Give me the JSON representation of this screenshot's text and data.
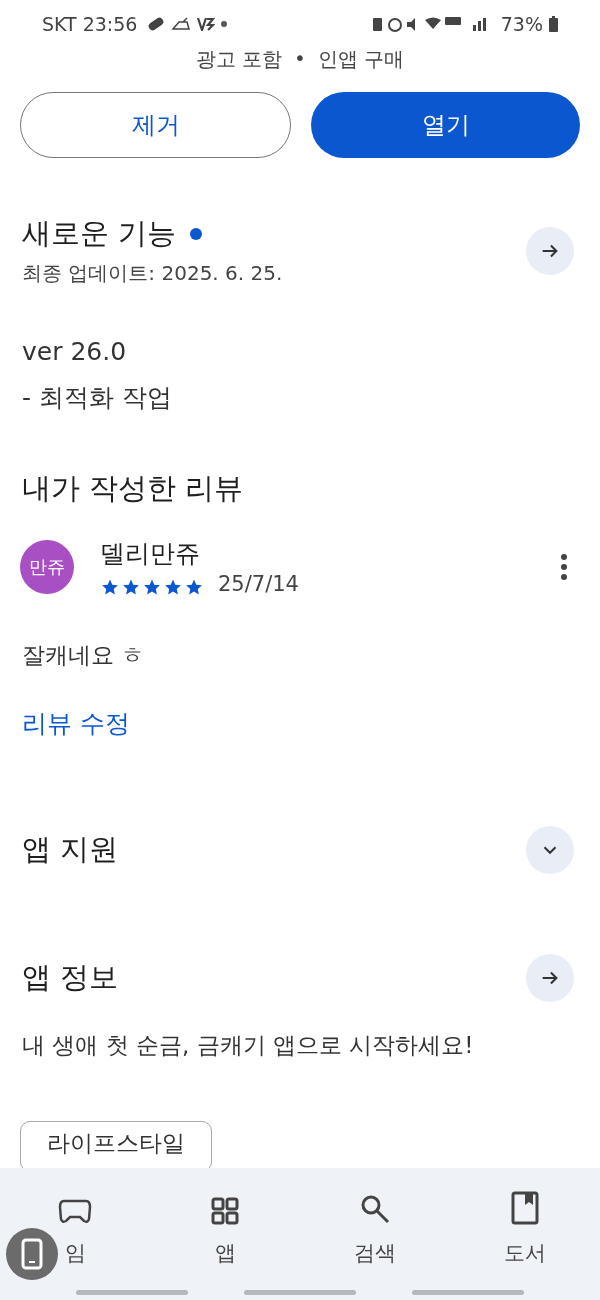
{
  "status_bar": {
    "carrier": "SKT",
    "time": "23:56",
    "battery": "73%"
  },
  "subtitle": {
    "left": "광고 포함",
    "separator": "•",
    "right": "인앱 구매"
  },
  "buttons": [
    {
      "label": "제거",
      "kind": "outline"
    },
    {
      "label": "열기",
      "kind": "filled"
    }
  ],
  "whats_new": {
    "title": "새로운 기능",
    "has_new": true,
    "updated": "최종 업데이트: 2025. 6. 25.",
    "lines": [
      "ver 26.0",
      "- 최적화 작업"
    ]
  },
  "my_review": {
    "title": "내가 작성한 리뷰",
    "avatar": "만쥬",
    "author": "델리만쥬",
    "stars": 5,
    "date": "25/7/14",
    "text": "잘캐네요 ㅎ",
    "edit_link": "리뷰 수정"
  },
  "sections": [
    {
      "title": "앱 지원",
      "kind": "expand"
    },
    {
      "title": "앱 정보",
      "kind": "arrow"
    }
  ],
  "description": "내 생애 첫 순금, 금캐기 앱으로 시작하세요!",
  "chips": [
    "라이프스타일"
  ],
  "bottom_nav": [
    {
      "label": "임",
      "kind": "games"
    },
    {
      "label": "앱",
      "kind": "apps"
    },
    {
      "label": "검색",
      "kind": "search"
    },
    {
      "label": "도서",
      "kind": "books"
    }
  ]
}
